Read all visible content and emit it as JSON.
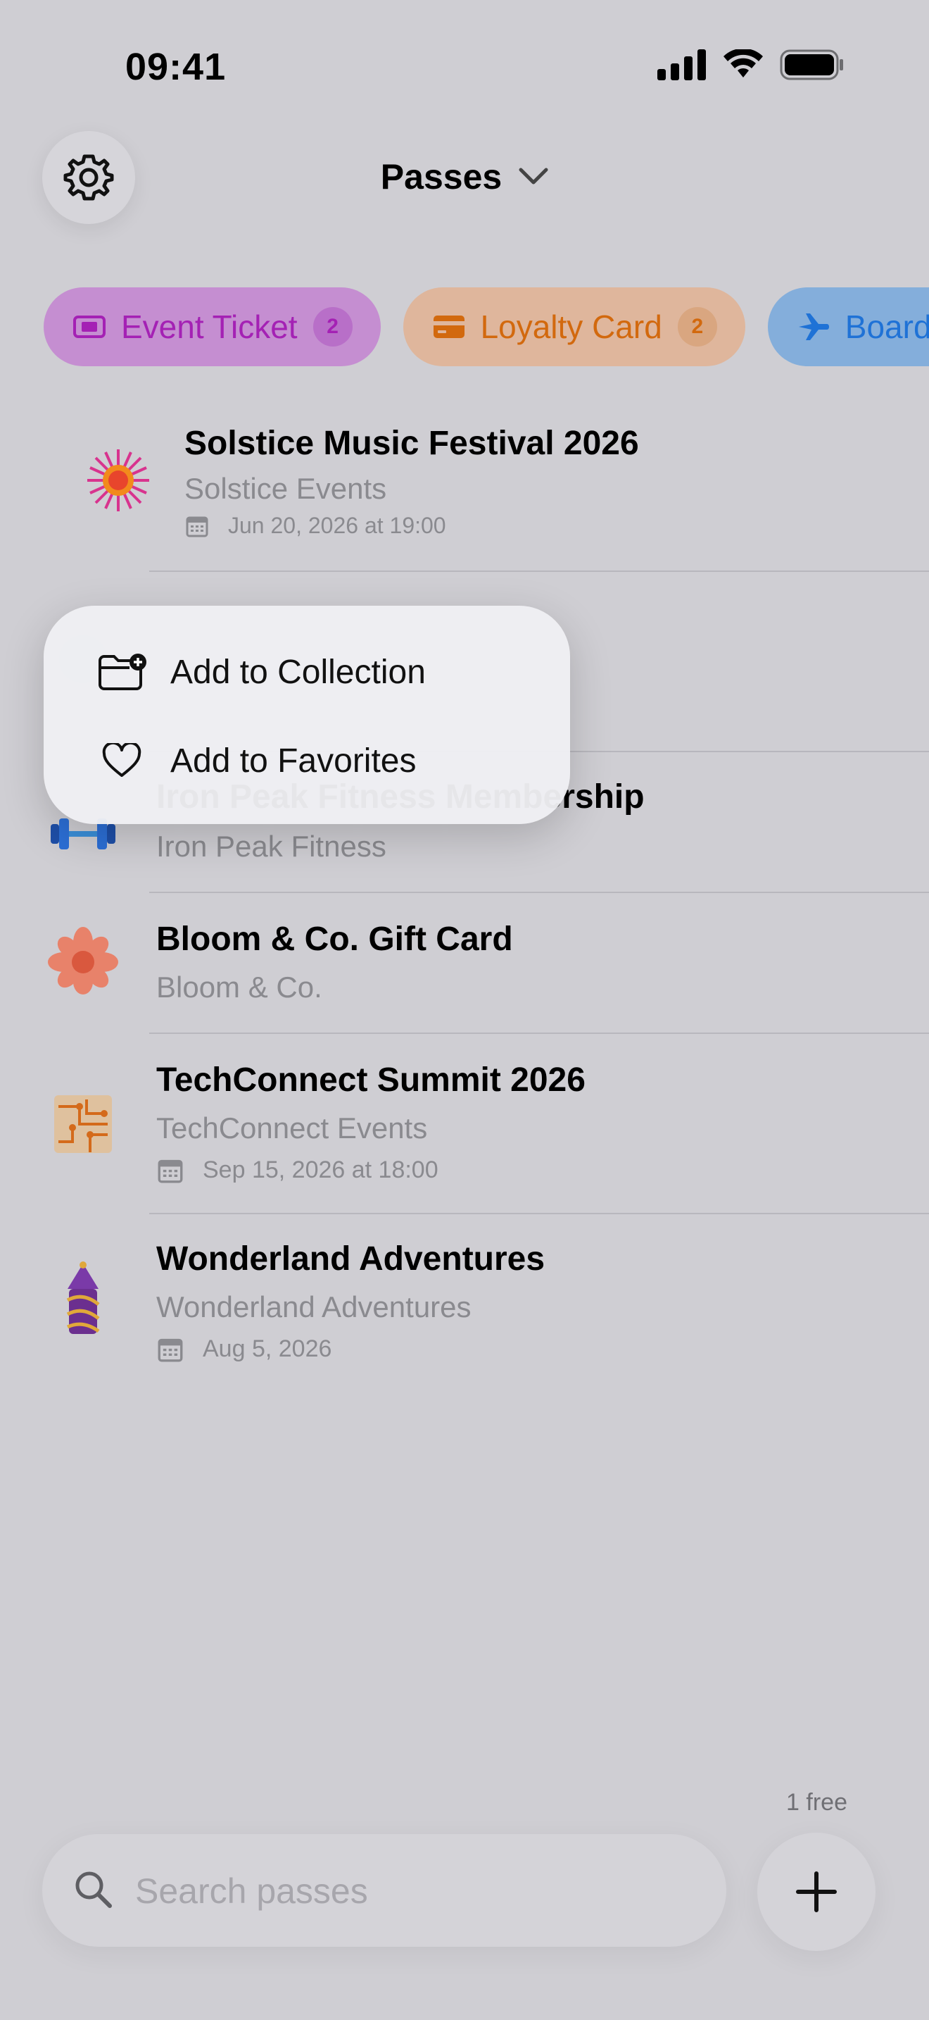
{
  "status_bar": {
    "time": "09:41"
  },
  "header": {
    "title": "Passes"
  },
  "filters": [
    {
      "label": "Event Ticket",
      "count": "2"
    },
    {
      "label": "Loyalty Card",
      "count": "2"
    },
    {
      "label": "Boarding Pass"
    }
  ],
  "passes": [
    {
      "title": "Solstice Music Festival 2026",
      "issuer": "Solstice Events",
      "date": "Jun 20, 2026 at 19:00"
    },
    {
      "title": "",
      "issuer": "",
      "date": ""
    },
    {
      "title": "Iron Peak Fitness Membership",
      "issuer": "Iron Peak Fitness"
    },
    {
      "title": "Bloom & Co. Gift Card",
      "issuer": "Bloom & Co."
    },
    {
      "title": "TechConnect Summit 2026",
      "issuer": "TechConnect Events",
      "date": "Sep 15, 2026 at 18:00"
    },
    {
      "title": "Wonderland Adventures",
      "issuer": "Wonderland Adventures",
      "date": "Aug 5, 2026"
    }
  ],
  "context_menu": {
    "items": [
      {
        "label": "Add to Collection",
        "icon": "folder-plus-icon"
      },
      {
        "label": "Add to Favorites",
        "icon": "heart-icon"
      }
    ]
  },
  "footer": {
    "free_label": "1 free",
    "search_placeholder": "Search passes"
  },
  "colors": {
    "background": "#cfced3",
    "event_ticket": "#a421b4",
    "loyalty_card": "#d2690e",
    "boarding_pass": "#1f72d6"
  }
}
